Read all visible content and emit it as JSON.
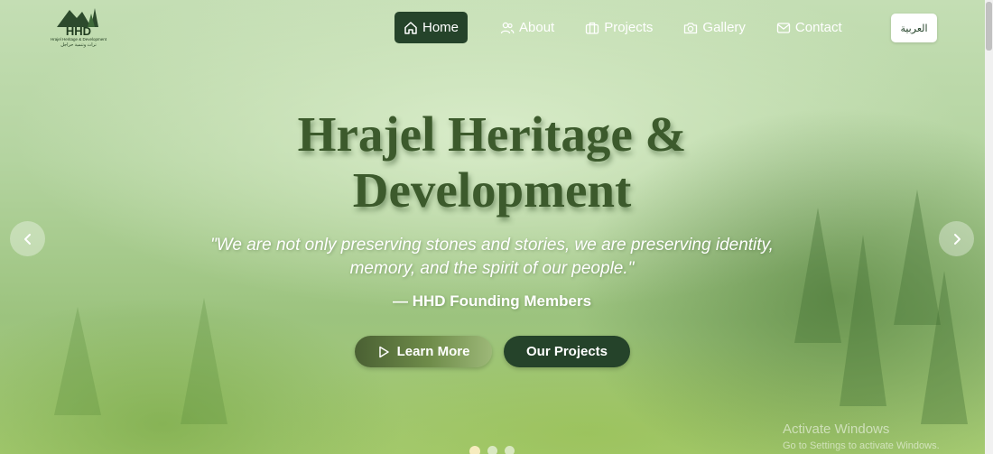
{
  "logo": {
    "abbr": "HHD",
    "full_name": "Hrajel Heritage & Development",
    "arabic_name": "تراث وتنمية حراجل"
  },
  "nav": {
    "items": [
      {
        "label": "Home",
        "icon": "home-icon",
        "active": true
      },
      {
        "label": "About",
        "icon": "users-icon",
        "active": false
      },
      {
        "label": "Projects",
        "icon": "briefcase-icon",
        "active": false
      },
      {
        "label": "Gallery",
        "icon": "camera-icon",
        "active": false
      },
      {
        "label": "Contact",
        "icon": "mail-icon",
        "active": false
      }
    ],
    "language_button": "العربية"
  },
  "hero": {
    "title_line1": "Hrajel Heritage &",
    "title_line2": "Development",
    "quote_line1": "\"We are not only preserving stones and stories, we are preserving identity,",
    "quote_line2": "memory, and the spirit of our people.\"",
    "attribution": "— HHD Founding Members",
    "learn_more": "Learn More",
    "our_projects": "Our Projects",
    "slides": 3,
    "active_slide": 1
  },
  "watermark": {
    "title": "Activate Windows",
    "subtitle": "Go to Settings to activate Windows."
  },
  "colors": {
    "primary_dark_green": "#25432a",
    "title_green": "#3c5a2c",
    "white": "#ffffff"
  }
}
